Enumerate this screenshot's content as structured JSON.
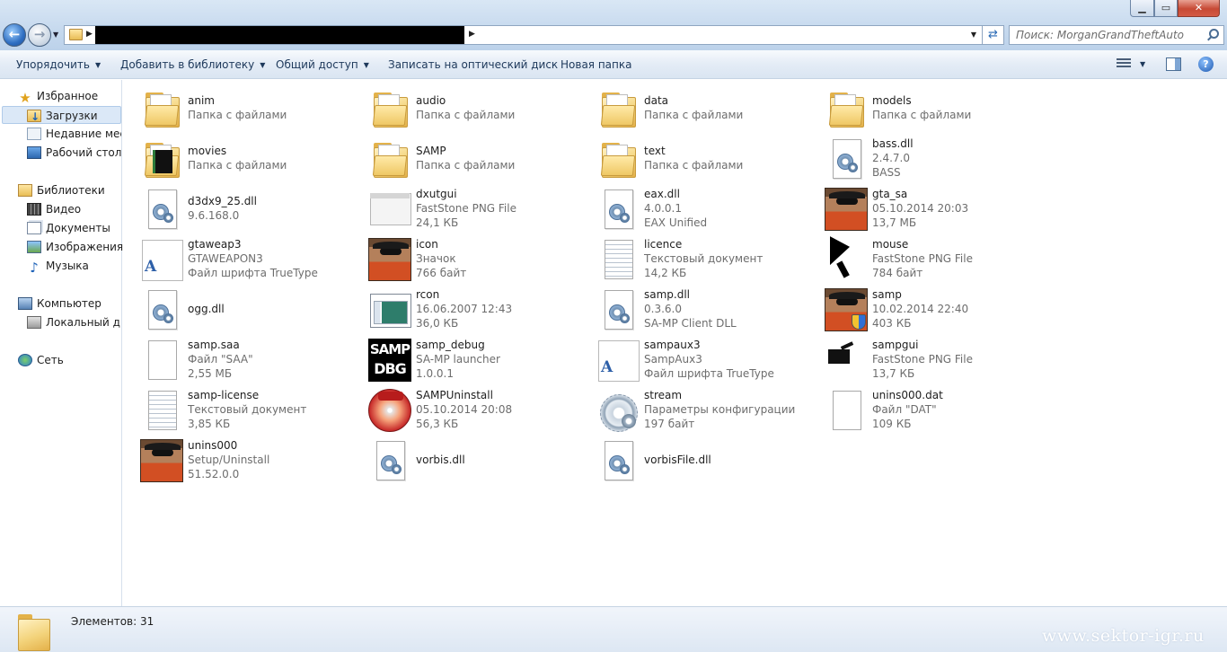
{
  "window": {
    "minimize_glyph": "▁",
    "maximize_glyph": "▭",
    "close_glyph": "✕"
  },
  "address": {
    "search_placeholder": "Поиск: MorganGrandTheftAuto"
  },
  "toolbar": {
    "organize": "Упорядочить",
    "add_to_library": "Добавить в библиотеку",
    "share": "Общий доступ",
    "burn": "Записать на оптический диск",
    "new_folder": "Новая папка",
    "help": "?"
  },
  "nav": {
    "favorites": "Избранное",
    "downloads": "Загрузки",
    "recent": "Недавние места",
    "desktop": "Рабочий стол",
    "libraries": "Библиотеки",
    "video": "Видео",
    "documents": "Документы",
    "pictures": "Изображения",
    "music": "Музыка",
    "computer": "Компьютер",
    "local_disk": "Локальный диск (C:)",
    "network": "Сеть"
  },
  "files": [
    {
      "name": "anim",
      "line1": "Папка с файлами",
      "line2": "",
      "icon": "folder-icon"
    },
    {
      "name": "audio",
      "line1": "Папка с файлами",
      "line2": "",
      "icon": "folder-icon"
    },
    {
      "name": "data",
      "line1": "Папка с файлами",
      "line2": "",
      "icon": "folder-icon"
    },
    {
      "name": "models",
      "line1": "Папка с файлами",
      "line2": "",
      "icon": "folder-icon"
    },
    {
      "name": "movies",
      "line1": "Папка с файлами",
      "line2": "",
      "icon": "video-folder-icon"
    },
    {
      "name": "SAMP",
      "line1": "Папка с файлами",
      "line2": "",
      "icon": "folder-icon"
    },
    {
      "name": "text",
      "line1": "Папка с файлами",
      "line2": "",
      "icon": "folder-icon"
    },
    {
      "name": "bass.dll",
      "line1": "2.4.7.0",
      "line2": "BASS",
      "icon": "dll-icon"
    },
    {
      "name": "d3dx9_25.dll",
      "line1": "9.6.168.0",
      "line2": "",
      "icon": "dll-icon"
    },
    {
      "name": "dxutgui",
      "line1": "FastStone PNG File",
      "line2": "24,1 КБ",
      "icon": "png-image-icon"
    },
    {
      "name": "eax.dll",
      "line1": "4.0.0.1",
      "line2": "EAX Unified",
      "icon": "dll-icon"
    },
    {
      "name": "gta_sa",
      "line1": "05.10.2014 20:03",
      "line2": "13,7 МБ",
      "icon": "gta-sa-exe-icon"
    },
    {
      "name": "gtaweap3",
      "line1": "GTAWEAPON3",
      "line2": "Файл шрифта TrueType",
      "icon": "font-icon"
    },
    {
      "name": "icon",
      "line1": "Значок",
      "line2": "766 байт",
      "icon": "gta-icon-file-icon"
    },
    {
      "name": "licence",
      "line1": "Текстовый документ",
      "line2": "14,2 КБ",
      "icon": "text-document-icon"
    },
    {
      "name": "mouse",
      "line1": "FastStone PNG File",
      "line2": "784 байт",
      "icon": "mouse-cursor-icon"
    },
    {
      "name": "ogg.dll",
      "line1": "",
      "line2": "",
      "icon": "dll-icon"
    },
    {
      "name": "rcon",
      "line1": "16.06.2007 12:43",
      "line2": "36,0 КБ",
      "icon": "application-window-icon"
    },
    {
      "name": "samp.dll",
      "line1": "0.3.6.0",
      "line2": "SA-MP Client DLL",
      "icon": "dll-icon"
    },
    {
      "name": "samp",
      "line1": "10.02.2014 22:40",
      "line2": "403 КБ",
      "icon": "samp-exe-icon"
    },
    {
      "name": "samp.saa",
      "line1": "Файл \"SAA\"",
      "line2": "2,55 МБ",
      "icon": "blank-file-icon"
    },
    {
      "name": "samp_debug",
      "line1": "SA-MP launcher",
      "line2": "1.0.0.1",
      "icon": "samp-debug-icon"
    },
    {
      "name": "sampaux3",
      "line1": "SampAux3",
      "line2": "Файл шрифта TrueType",
      "icon": "font-icon"
    },
    {
      "name": "sampgui",
      "line1": "FastStone PNG File",
      "line2": "13,7 КБ",
      "icon": "png-image-dark-icon"
    },
    {
      "name": "samp-license",
      "line1": "Текстовый документ",
      "line2": "3,85 КБ",
      "icon": "text-document-icon"
    },
    {
      "name": "SAMPUninstall",
      "line1": "05.10.2014 20:08",
      "line2": "56,3 КБ",
      "icon": "uninstall-disc-icon"
    },
    {
      "name": "stream",
      "line1": "Параметры конфигурации",
      "line2": "197 байт",
      "icon": "config-gear-icon"
    },
    {
      "name": "unins000.dat",
      "line1": "Файл \"DAT\"",
      "line2": "109 КБ",
      "icon": "blank-file-icon"
    },
    {
      "name": "unins000",
      "line1": "Setup/Uninstall",
      "line2": "51.52.0.0",
      "icon": "gta-uninstall-icon"
    },
    {
      "name": "vorbis.dll",
      "line1": "",
      "line2": "",
      "icon": "dll-icon"
    },
    {
      "name": "vorbisFile.dll",
      "line1": "",
      "line2": "",
      "icon": "dll-icon"
    }
  ],
  "status": {
    "items_count": "Элементов: 31",
    "watermark": "www.sektor-igr.ru"
  },
  "colors": {
    "chrome_blue": "#c6d9ee",
    "selection": "#dbe8f7",
    "secondary_text": "#6d6d6d",
    "toolbar_text": "#1e395b"
  }
}
